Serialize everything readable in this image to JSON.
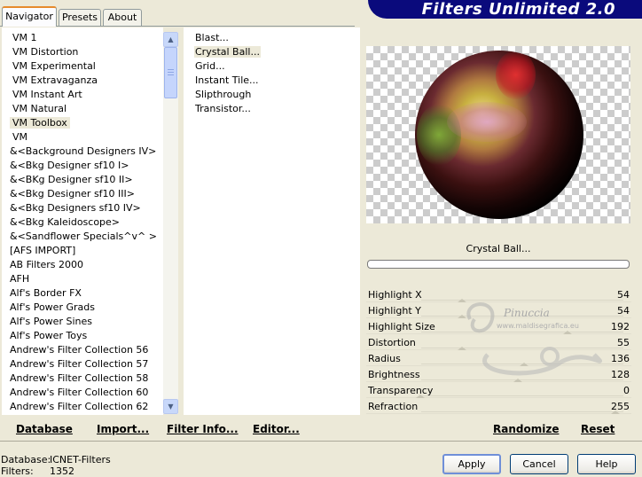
{
  "tabs": [
    {
      "label": "Navigator",
      "active": true
    },
    {
      "label": "Presets",
      "active": false
    },
    {
      "label": "About",
      "active": false
    }
  ],
  "app_title": "Filters Unlimited 2.0",
  "categories": [
    "VM 1",
    "VM Distortion",
    "VM Experimental",
    "VM Extravaganza",
    "VM Instant Art",
    "VM Natural",
    "VM Toolbox",
    "VM",
    "&<Background Designers IV>",
    "&<Bkg Designer sf10 I>",
    "&<BKg Designer sf10 II>",
    "&<Bkg Designer sf10 III>",
    "&<Bkg Designers sf10 IV>",
    "&<Bkg Kaleidoscope>",
    "&<Sandflower Specials^v^ >",
    "[AFS IMPORT]",
    "AB Filters 2000",
    "AFH",
    "Alf's Border FX",
    "Alf's Power Grads",
    "Alf's Power Sines",
    "Alf's Power Toys",
    "Andrew's Filter Collection 56",
    "Andrew's Filter Collection 57",
    "Andrew's Filter Collection 58",
    "Andrew's Filter Collection 60",
    "Andrew's Filter Collection 62"
  ],
  "selected_category": "VM Toolbox",
  "filters": [
    "Blast...",
    "Crystal Ball...",
    "Grid...",
    "Instant Tile...",
    "Slipthrough",
    "Transistor..."
  ],
  "selected_filter": "Crystal Ball...",
  "preview_filter_name": "Crystal Ball...",
  "parameters": [
    {
      "label": "Highlight X",
      "value": "54"
    },
    {
      "label": "Highlight Y",
      "value": "54"
    },
    {
      "label": "Highlight Size",
      "value": "192"
    },
    {
      "label": "Distortion",
      "value": "55"
    },
    {
      "label": "Radius",
      "value": "136"
    },
    {
      "label": "Brightness",
      "value": "128"
    },
    {
      "label": "Transparency",
      "value": "0"
    },
    {
      "label": "Refraction",
      "value": "255"
    }
  ],
  "bottom_buttons": {
    "database": "Database",
    "import": "Import...",
    "filter_info": "Filter Info...",
    "editor": "Editor...",
    "randomize": "Randomize",
    "reset": "Reset"
  },
  "status": {
    "database_label": "Database:",
    "database_value": "ICNET-Filters",
    "filters_label": "Filters:",
    "filters_value": "1352"
  },
  "dialog_buttons": {
    "apply": "Apply",
    "cancel": "Cancel",
    "help": "Help"
  },
  "watermark": {
    "name": "Pinuccia",
    "url": "www.maldisegrafica.eu"
  },
  "colors": {
    "banner": "#0a0a7c",
    "accent_tab": "#e68b2c",
    "dialog_bg": "#ece9d8"
  }
}
